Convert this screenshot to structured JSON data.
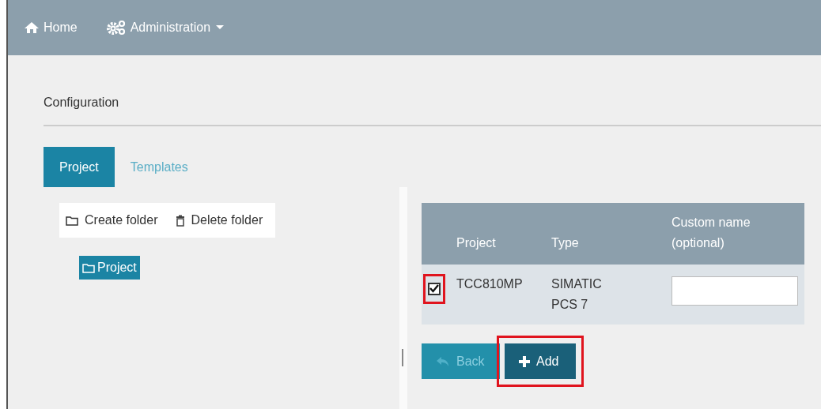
{
  "navbar": {
    "items": [
      {
        "label": "Home",
        "kind": "home",
        "dropdown": false
      },
      {
        "label": "Administration",
        "kind": "admin",
        "dropdown": true
      }
    ]
  },
  "page_title": "Configuration",
  "tabs": [
    {
      "label": "Project",
      "selected": true
    },
    {
      "label": "Templates",
      "selected": false
    }
  ],
  "toolbar": [
    {
      "label": "Create folder",
      "kind": "folder"
    },
    {
      "label": "Delete folder",
      "kind": "trash"
    }
  ],
  "tree": [
    {
      "label": "Project",
      "selected": true
    }
  ],
  "table": {
    "columns": [
      "Project",
      "Type",
      "Custom name (optional)"
    ],
    "rows": [
      {
        "checked": true,
        "highlighted": true,
        "project": "TCC810MP",
        "type": "SIMATIC PCS 7",
        "custom_name": ""
      }
    ]
  },
  "buttons": [
    {
      "label": "Back",
      "kind": "back",
      "disabled": true,
      "highlighted": false
    },
    {
      "label": "Add",
      "kind": "add",
      "disabled": false,
      "highlighted": true
    }
  ]
}
